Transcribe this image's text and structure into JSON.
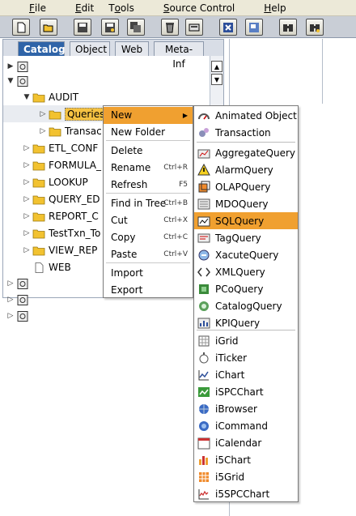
{
  "menubar": {
    "items": [
      {
        "label": "File",
        "mnemonic": "F"
      },
      {
        "label": "Edit",
        "mnemonic": "E"
      },
      {
        "label": "Tools",
        "mnemonic": "o"
      },
      {
        "label": "Source Control",
        "mnemonic": "S"
      },
      {
        "label": "Help",
        "mnemonic": "H"
      }
    ]
  },
  "toolbar": {
    "buttons": [
      "new-document-icon",
      "open-folder-icon",
      "save-icon",
      "save-as-icon",
      "save-all-icon",
      "delete-icon",
      "properties-icon",
      "close-icon",
      "preview-icon",
      "find-icon",
      "find-replace-icon"
    ]
  },
  "tabs": [
    {
      "label": "Catalog",
      "active": true
    },
    {
      "label": "Object",
      "active": false
    },
    {
      "label": "Web",
      "active": false
    },
    {
      "label": "Meta-Inf",
      "active": false
    }
  ],
  "tree": [
    {
      "label": "",
      "icon": "project-icon",
      "expander": "▶",
      "level": 0
    },
    {
      "label": "",
      "icon": "project-icon",
      "expander": "▼",
      "level": 0
    },
    {
      "label": "AUDIT",
      "icon": "folder-icon",
      "expander": "▼",
      "level": 1
    },
    {
      "label": "Queries",
      "icon": "folder-icon",
      "expander": "▷",
      "level": 2,
      "selected": true
    },
    {
      "label": "Transac",
      "icon": "folder-icon",
      "expander": "▷",
      "level": 2
    },
    {
      "label": "ETL_CONF",
      "icon": "folder-icon",
      "expander": "▷",
      "level": 1
    },
    {
      "label": "FORMULA_",
      "icon": "folder-icon",
      "expander": "▷",
      "level": 1
    },
    {
      "label": "LOOKUP",
      "icon": "folder-icon",
      "expander": "▷",
      "level": 1
    },
    {
      "label": "QUERY_ED",
      "icon": "folder-icon",
      "expander": "▷",
      "level": 1
    },
    {
      "label": "REPORT_C",
      "icon": "folder-icon",
      "expander": "▷",
      "level": 1
    },
    {
      "label": "TestTxn_To",
      "icon": "folder-icon",
      "expander": "▷",
      "level": 1
    },
    {
      "label": "VIEW_REP",
      "icon": "folder-icon",
      "expander": "▷",
      "level": 1
    },
    {
      "label": "WEB",
      "icon": "file-icon",
      "expander": "",
      "level": 1
    },
    {
      "label": "",
      "icon": "project-icon",
      "expander": "▷",
      "level": 0
    },
    {
      "label": "",
      "icon": "project-icon",
      "expander": "▷",
      "level": 0
    },
    {
      "label": "",
      "icon": "project-icon",
      "expander": "▷",
      "level": 0
    }
  ],
  "context_menu": {
    "items": [
      {
        "label": "New",
        "shortcut": "",
        "submenu": true,
        "highlighted": true
      },
      {
        "label": "New Folder",
        "shortcut": ""
      },
      {
        "label": "Delete",
        "shortcut": ""
      },
      {
        "label": "Rename",
        "shortcut": "Ctrl+R"
      },
      {
        "label": "Refresh",
        "shortcut": "F5"
      },
      {
        "label": "Find in Tree",
        "shortcut": "Ctrl+B"
      },
      {
        "label": "Cut",
        "shortcut": "Ctrl+X"
      },
      {
        "label": "Copy",
        "shortcut": "Ctrl+C"
      },
      {
        "label": "Paste",
        "shortcut": "Ctrl+V"
      },
      {
        "label": "Import",
        "shortcut": ""
      },
      {
        "label": "Export",
        "shortcut": ""
      }
    ]
  },
  "submenu": {
    "items": [
      {
        "label": "Animated Object",
        "icon": "animated-object-icon"
      },
      {
        "label": "Transaction",
        "icon": "transaction-icon"
      },
      {
        "label": "AggregateQuery",
        "icon": "aggregate-query-icon"
      },
      {
        "label": "AlarmQuery",
        "icon": "alarm-query-icon"
      },
      {
        "label": "OLAPQuery",
        "icon": "olap-query-icon"
      },
      {
        "label": "MDOQuery",
        "icon": "mdo-query-icon"
      },
      {
        "label": "SQLQuery",
        "icon": "sql-query-icon",
        "highlighted": true
      },
      {
        "label": "TagQuery",
        "icon": "tag-query-icon"
      },
      {
        "label": "XacuteQuery",
        "icon": "xacute-query-icon"
      },
      {
        "label": "XMLQuery",
        "icon": "xml-query-icon"
      },
      {
        "label": "PCoQuery",
        "icon": "pco-query-icon"
      },
      {
        "label": "CatalogQuery",
        "icon": "catalog-query-icon"
      },
      {
        "label": "KPIQuery",
        "icon": "kpi-query-icon"
      },
      {
        "label": "iGrid",
        "icon": "igrid-icon"
      },
      {
        "label": "iTicker",
        "icon": "iticker-icon"
      },
      {
        "label": "iChart",
        "icon": "ichart-icon"
      },
      {
        "label": "iSPCChart",
        "icon": "ispcchart-icon"
      },
      {
        "label": "iBrowser",
        "icon": "ibrowser-icon"
      },
      {
        "label": "iCommand",
        "icon": "icommand-icon"
      },
      {
        "label": "iCalendar",
        "icon": "icalendar-icon"
      },
      {
        "label": "i5Chart",
        "icon": "i5chart-icon"
      },
      {
        "label": "i5Grid",
        "icon": "i5grid-icon"
      },
      {
        "label": "i5SPCChart",
        "icon": "i5spcchart-icon"
      }
    ]
  },
  "colors": {
    "highlight": "#f0a030",
    "active_tab": "#2f64a8",
    "folder": "#f2c230"
  }
}
